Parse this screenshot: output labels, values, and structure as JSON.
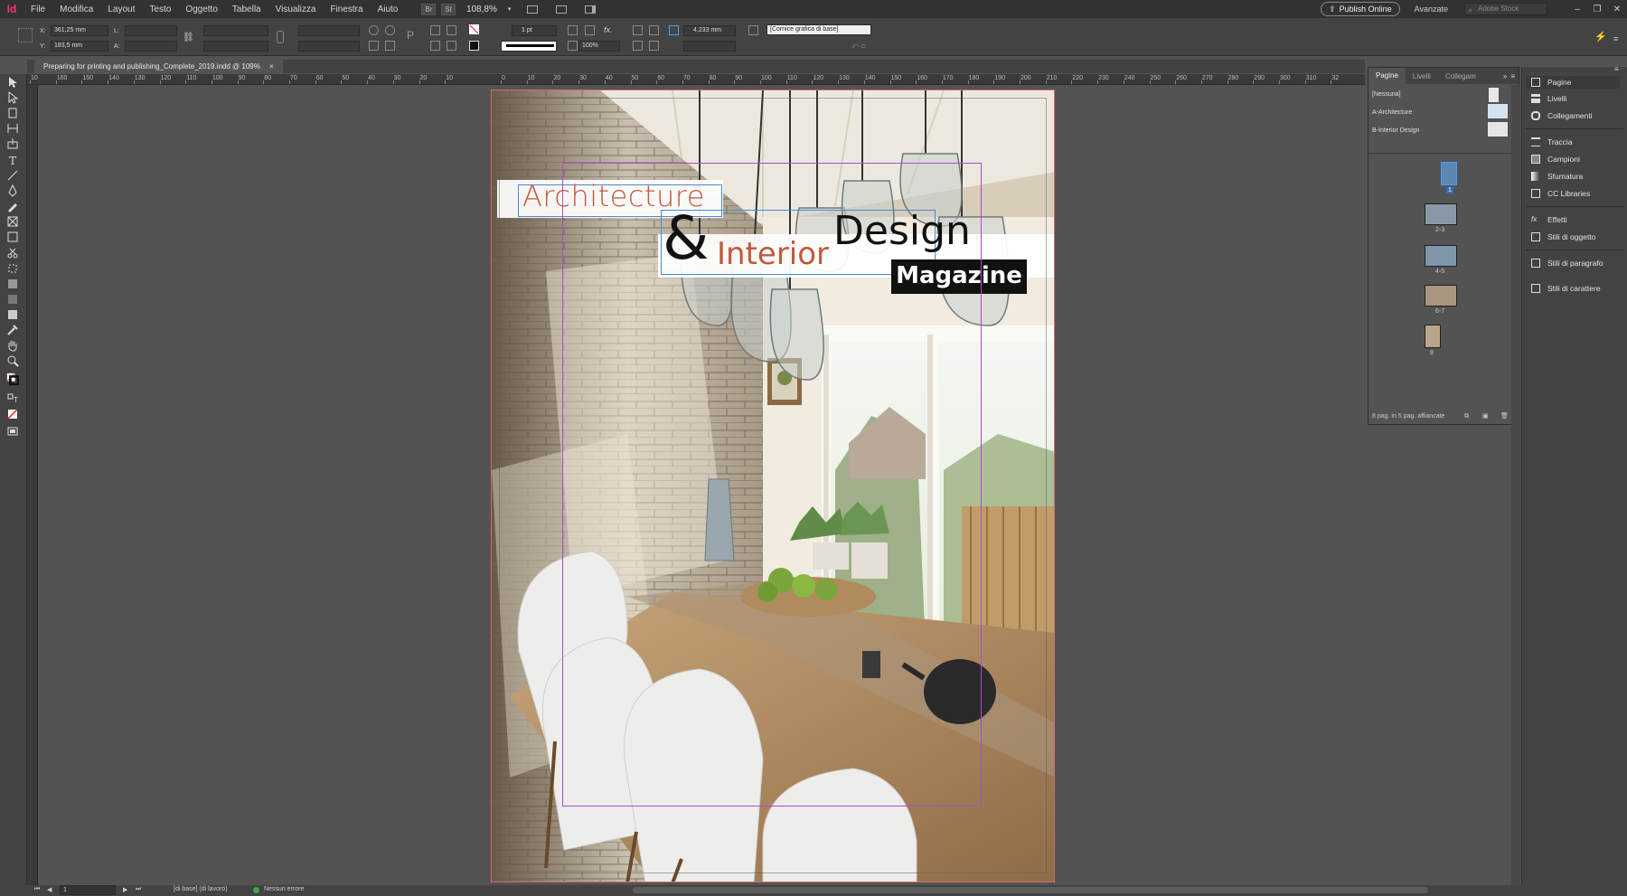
{
  "app": {
    "logo": "Id"
  },
  "menu": [
    "File",
    "Modifica",
    "Layout",
    "Testo",
    "Oggetto",
    "Tabella",
    "Visualizza",
    "Finestra",
    "Aiuto"
  ],
  "menubar": {
    "br_label": "Br",
    "st_label": "St",
    "zoom": "108,8%",
    "publish_label": "Publish Online",
    "workspace": "Avanzate",
    "stock_placeholder": "Adobe Stock"
  },
  "control": {
    "x_label": "X:",
    "x_value": "361,25 mm",
    "y_label": "Y:",
    "y_value": "183,5 mm",
    "w_label": "L:",
    "h_label": "A:",
    "stroke_weight": "1 pt",
    "opacity": "100%",
    "dimension": "4,233 mm",
    "object_style": "[Cornice grafica di base]"
  },
  "tab": {
    "title": "Preparing for printing and publishing_Complete_2019.indd @ 109%",
    "close": "×"
  },
  "ruler": {
    "left_numbers": [
      "10",
      "160",
      "150",
      "140",
      "130",
      "120",
      "110",
      "100",
      "90",
      "80",
      "70",
      "60",
      "50",
      "40",
      "30",
      "20",
      "10"
    ],
    "right_numbers": [
      "0",
      "10",
      "20",
      "30",
      "40",
      "50",
      "60",
      "70",
      "80",
      "90",
      "100",
      "110",
      "120",
      "130",
      "140",
      "150",
      "160",
      "170",
      "180",
      "190",
      "200",
      "210",
      "220",
      "230",
      "240",
      "250",
      "260",
      "270",
      "280",
      "290",
      "300",
      "310",
      "32"
    ]
  },
  "cover": {
    "architecture": "Architecture",
    "ampersand": "&",
    "interior": "Interior",
    "design": "Design",
    "magazine": "Magazine"
  },
  "pages_panel": {
    "tabs": [
      "Pagine",
      "Livelli",
      "Collegam"
    ],
    "masters": [
      "[Nessuna]",
      "A-Architecture",
      "B-Interior Design"
    ],
    "page_labels": [
      "1",
      "2-3",
      "4-5",
      "6-7",
      "8"
    ],
    "footer": "8 pag. in 5 pag. affiancate"
  },
  "dock": {
    "items": [
      "Pagine",
      "Livelli",
      "Collegamenti",
      "Traccia",
      "Campioni",
      "Sfumatura",
      "CC Libraries",
      "Effetti",
      "Stili di oggetto",
      "Stili di paragrafo",
      "Stili di carattere"
    ]
  },
  "status": {
    "page": "1",
    "layer": "[di base] (di lavoro)",
    "preflight": "Nessun errore"
  },
  "colors": {
    "accent_title": "#c15a3a",
    "ui_dark": "#323232",
    "ui_mid": "#434343",
    "canvas": "#535353",
    "preflight_ok": "#3aa64a"
  }
}
